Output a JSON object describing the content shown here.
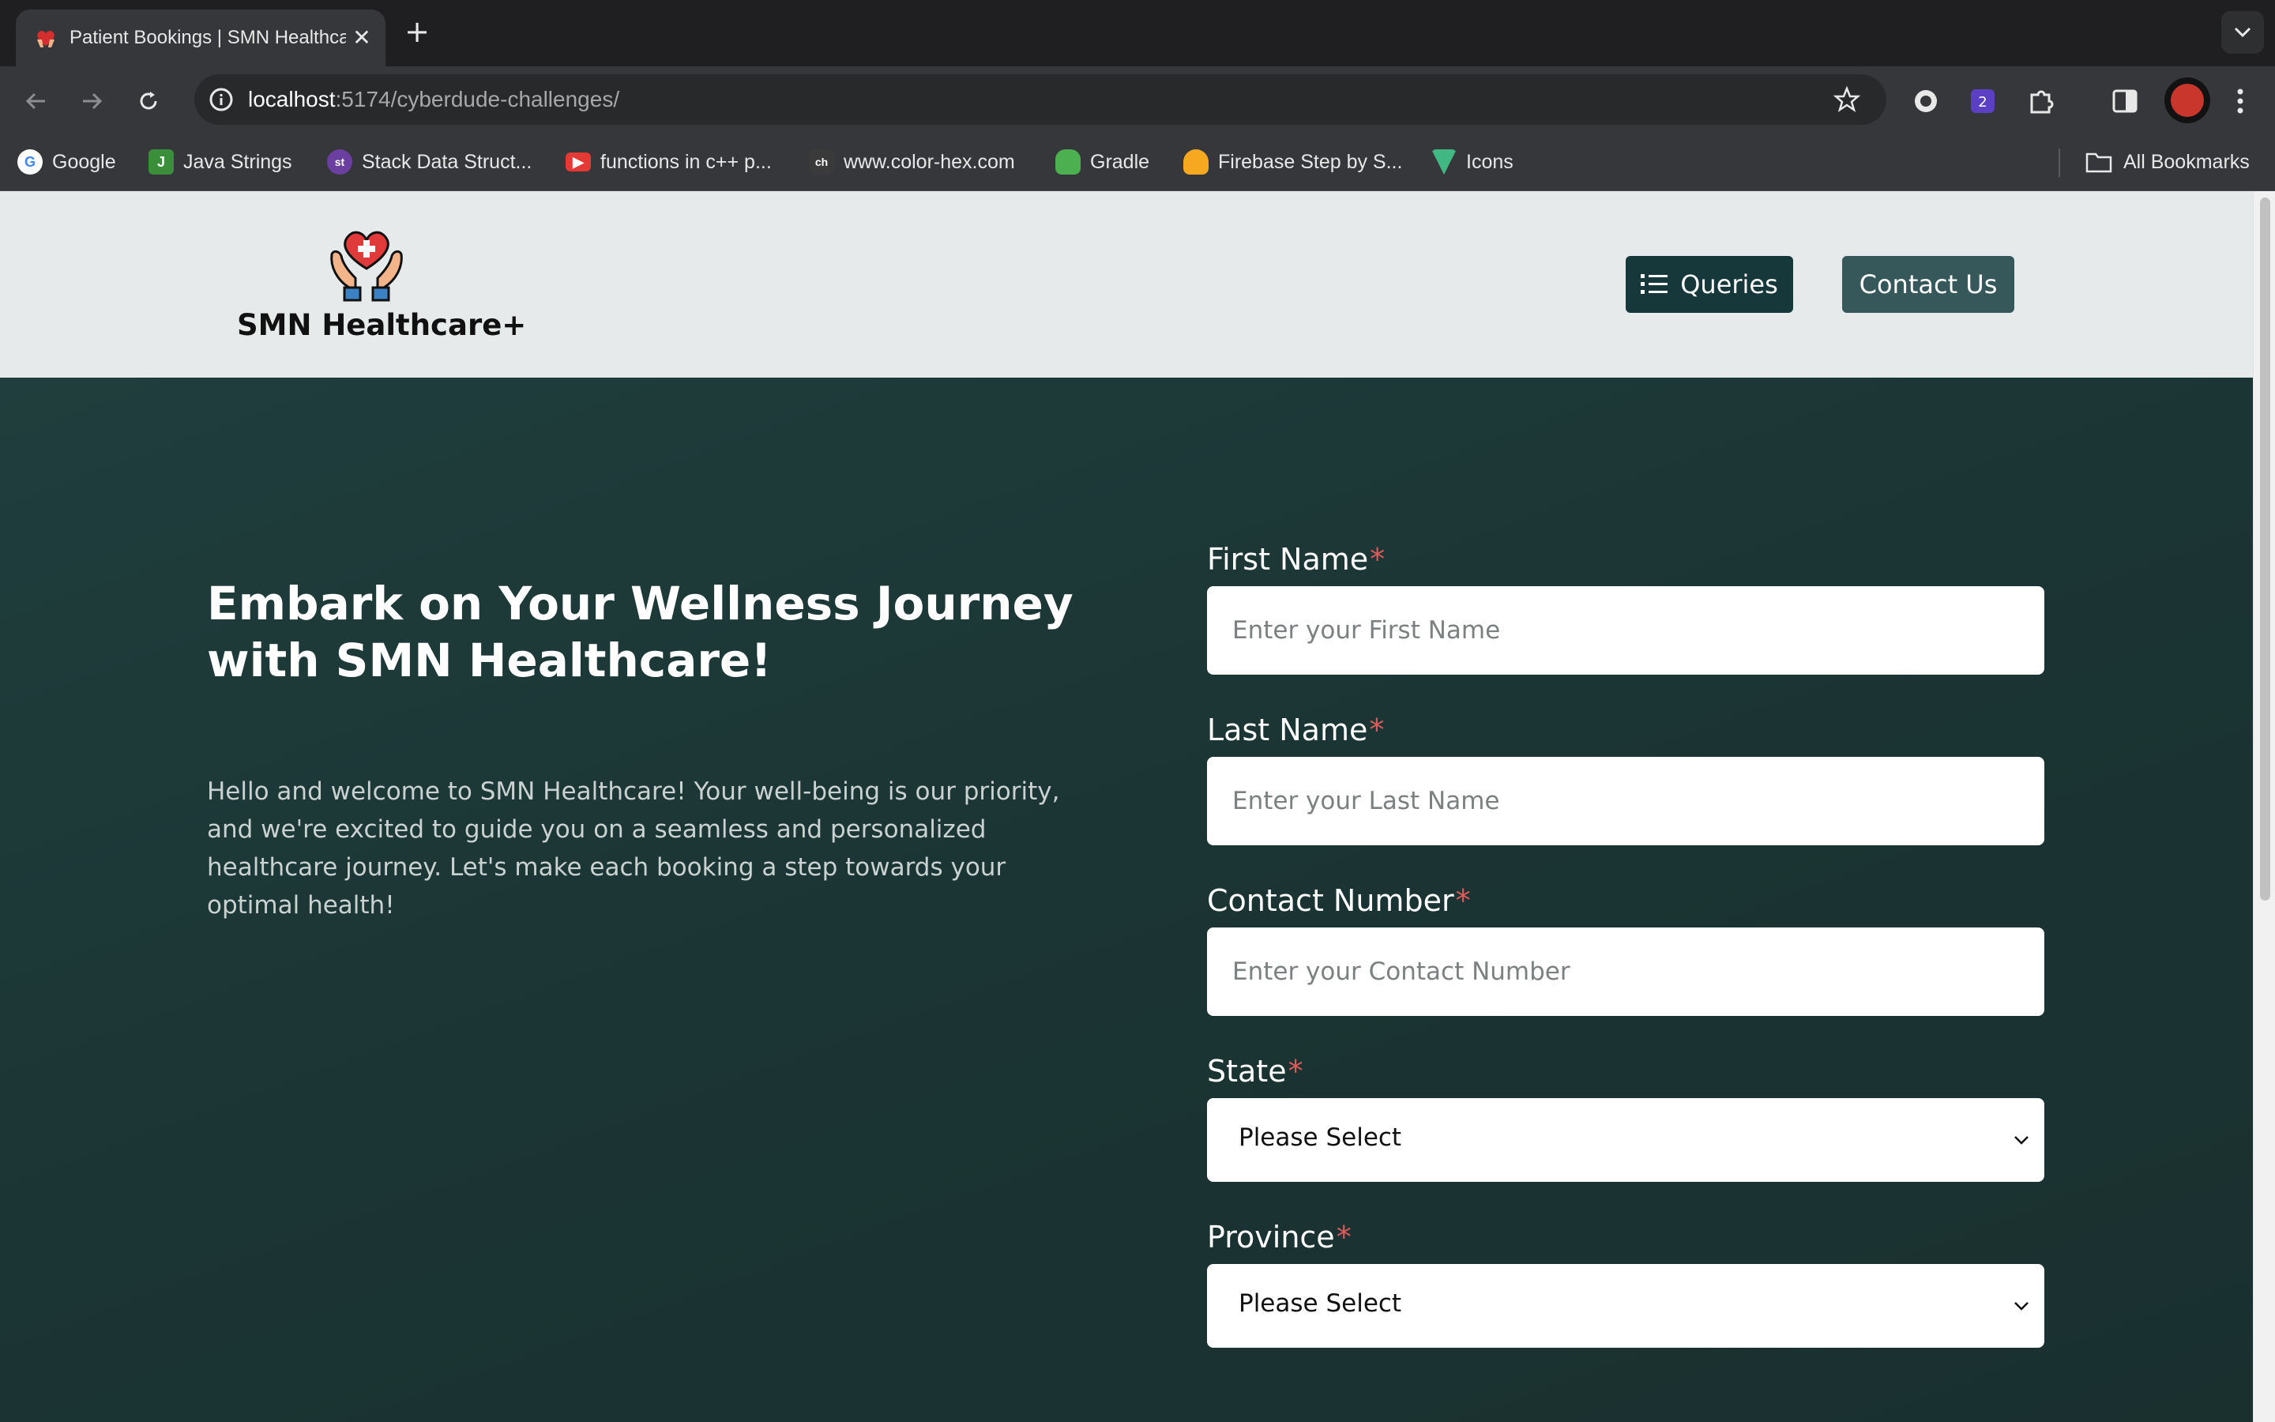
{
  "browser": {
    "tab_title": "Patient Bookings | SMN Healthcare",
    "tab_close": "✕",
    "new_tab": "+",
    "url_host": "localhost",
    "url_path": ":5174/cyberdude-challenges/",
    "bookmarks": [
      {
        "label": "Google",
        "icon": "google-icon",
        "color": "#ffffff"
      },
      {
        "label": "Java Strings",
        "icon": "java-strings-icon",
        "color": "#3b8f3a"
      },
      {
        "label": "Stack Data Struct...",
        "icon": "stack-data-icon",
        "color": "#6b3fa0"
      },
      {
        "label": "functions in c++ p...",
        "icon": "youtube-icon",
        "color": "#e53935"
      },
      {
        "label": "www.color-hex.com",
        "icon": "color-hex-icon",
        "color": "#3a3a3a"
      },
      {
        "label": "Gradle",
        "icon": "gradle-icon",
        "color": "#4caf50"
      },
      {
        "label": "Firebase Step by S...",
        "icon": "firebase-icon",
        "color": "#f6a821"
      },
      {
        "label": "Icons",
        "icon": "icons-site-icon",
        "color": "#41b883"
      }
    ],
    "all_bookmarks": "All Bookmarks"
  },
  "site": {
    "brand": "SMN Healthcare+",
    "nav": {
      "queries": "Queries",
      "contact": "Contact Us"
    },
    "colors": {
      "header_bg": "#e6eaea",
      "hero_bg": "#1d3a39",
      "button_dark": "#17383a",
      "button_mid": "#36585a",
      "required": "#e05a5a"
    }
  },
  "hero": {
    "title_line1": "Embark on Your Wellness Journey",
    "title_line2": "with SMN Healthcare!",
    "intro_line1": "Hello and welcome to SMN Healthcare! Your well-being is our priority,",
    "intro_line2": "and we're excited to guide you on a seamless and personalized",
    "intro_line3": "healthcare journey. Let's make each booking a step towards your",
    "intro_line4": "optimal health!"
  },
  "form": {
    "required_mark": "*",
    "first_name": {
      "label": "First Name",
      "placeholder": "Enter your First Name"
    },
    "last_name": {
      "label": "Last Name",
      "placeholder": "Enter your Last Name"
    },
    "contact_number": {
      "label": "Contact Number",
      "placeholder": "Enter your Contact Number"
    },
    "state": {
      "label": "State",
      "value": "Please Select"
    },
    "province": {
      "label": "Province",
      "value": "Please Select"
    }
  }
}
